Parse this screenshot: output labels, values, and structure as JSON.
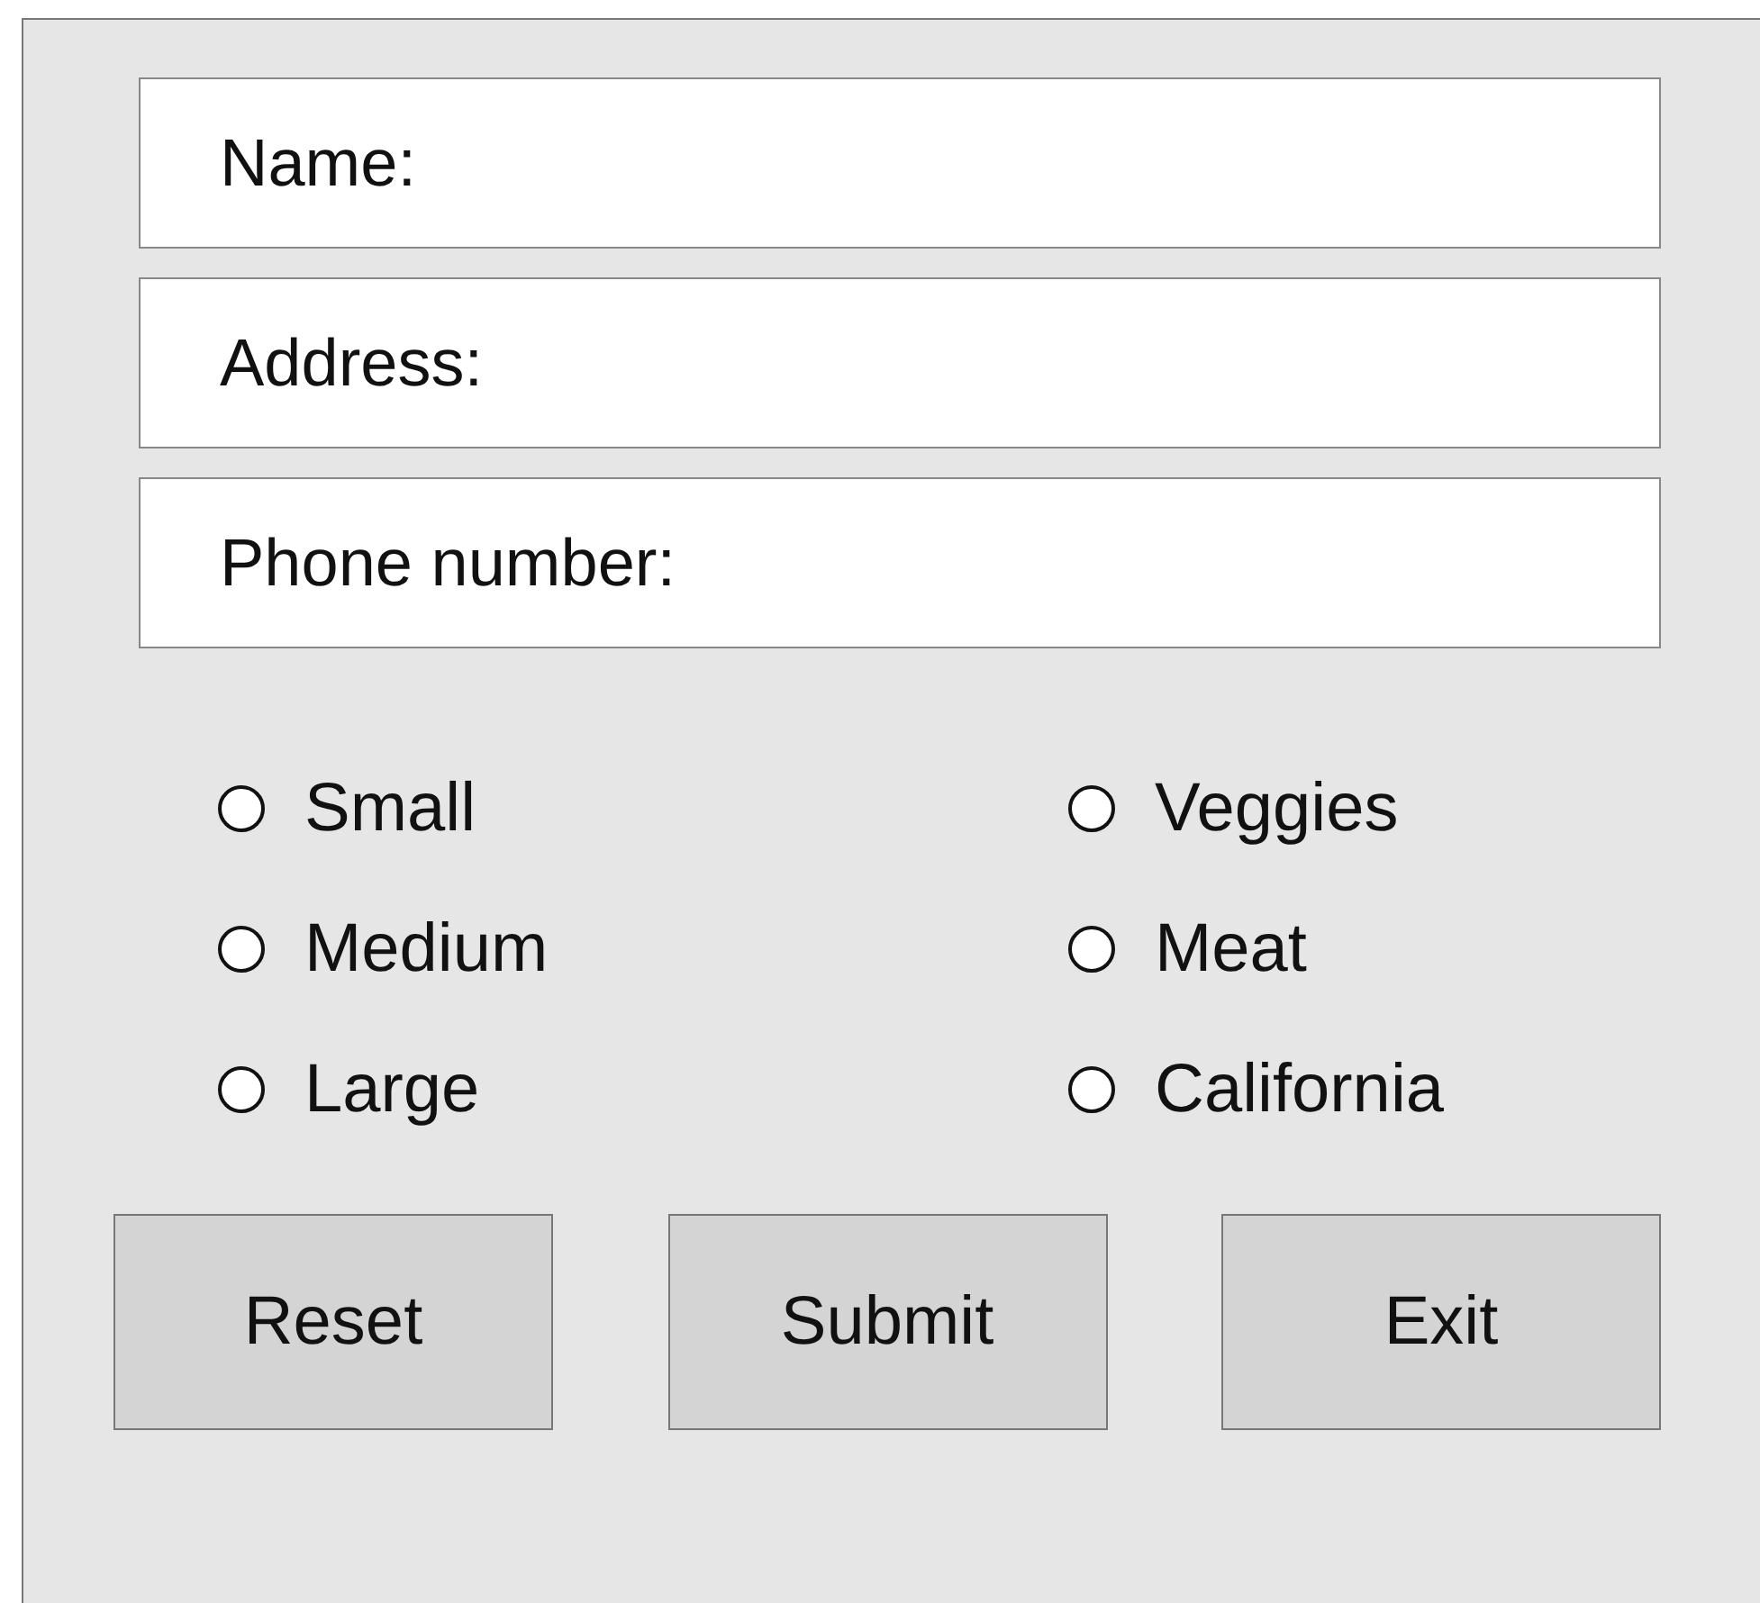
{
  "fields": [
    {
      "label": "Name:"
    },
    {
      "label": "Address:"
    },
    {
      "label": "Phone number:"
    }
  ],
  "radio_groups": [
    {
      "options": [
        {
          "label": "Small",
          "selected": false
        },
        {
          "label": "Medium",
          "selected": false
        },
        {
          "label": "Large",
          "selected": false
        }
      ]
    },
    {
      "options": [
        {
          "label": "Veggies",
          "selected": false
        },
        {
          "label": "Meat",
          "selected": false
        },
        {
          "label": "California",
          "selected": false
        }
      ]
    }
  ],
  "buttons": [
    "Reset",
    "Submit",
    "Exit"
  ]
}
